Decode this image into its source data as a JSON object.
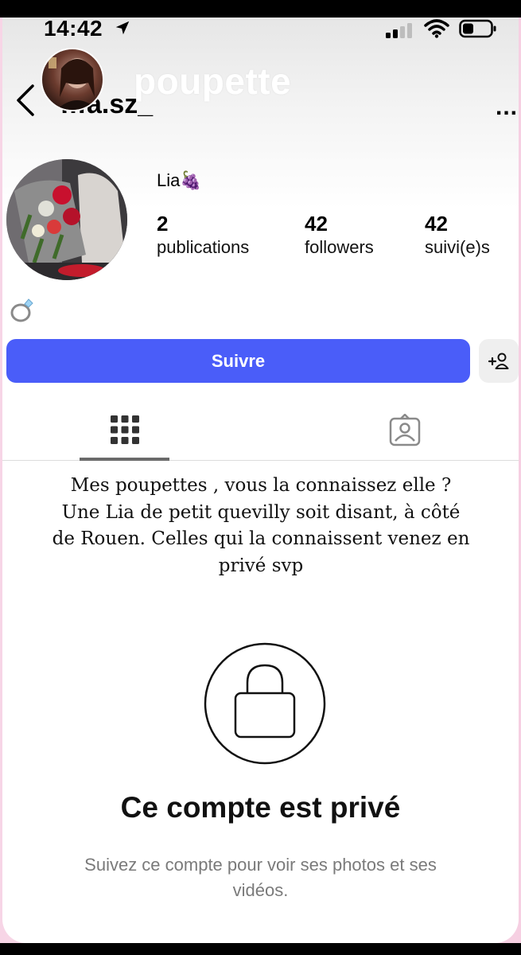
{
  "status_bar": {
    "time": "14:42"
  },
  "header": {
    "back_icon": "chevron-left-icon",
    "username": "…a.sz_",
    "overlay_text": "poupette",
    "more_label": "..."
  },
  "profile": {
    "name": "Lia🍇",
    "stats": [
      {
        "value": "2",
        "label": "publications"
      },
      {
        "value": "42",
        "label": "followers"
      },
      {
        "value": "42",
        "label": "suivi(e)s"
      }
    ],
    "bio_emoji": "ring-icon"
  },
  "actions": {
    "follow_label": "Suivre",
    "add_icon": "add-person-icon",
    "accent": "#4a5df9"
  },
  "tabs": [
    {
      "icon": "grid-icon"
    },
    {
      "icon": "tagged-icon"
    }
  ],
  "caption": {
    "lines": [
      "Mes poupettes , vous la connaissez elle ?",
      "Une Lia de petit quevilly soit disant, à côté",
      "de Rouen. Celles qui la connaissent venez en",
      "privé svp"
    ]
  },
  "private": {
    "title": "Ce compte est privé",
    "subtitle": "Suivez ce compte pour voir ses photos et ses vidéos."
  }
}
